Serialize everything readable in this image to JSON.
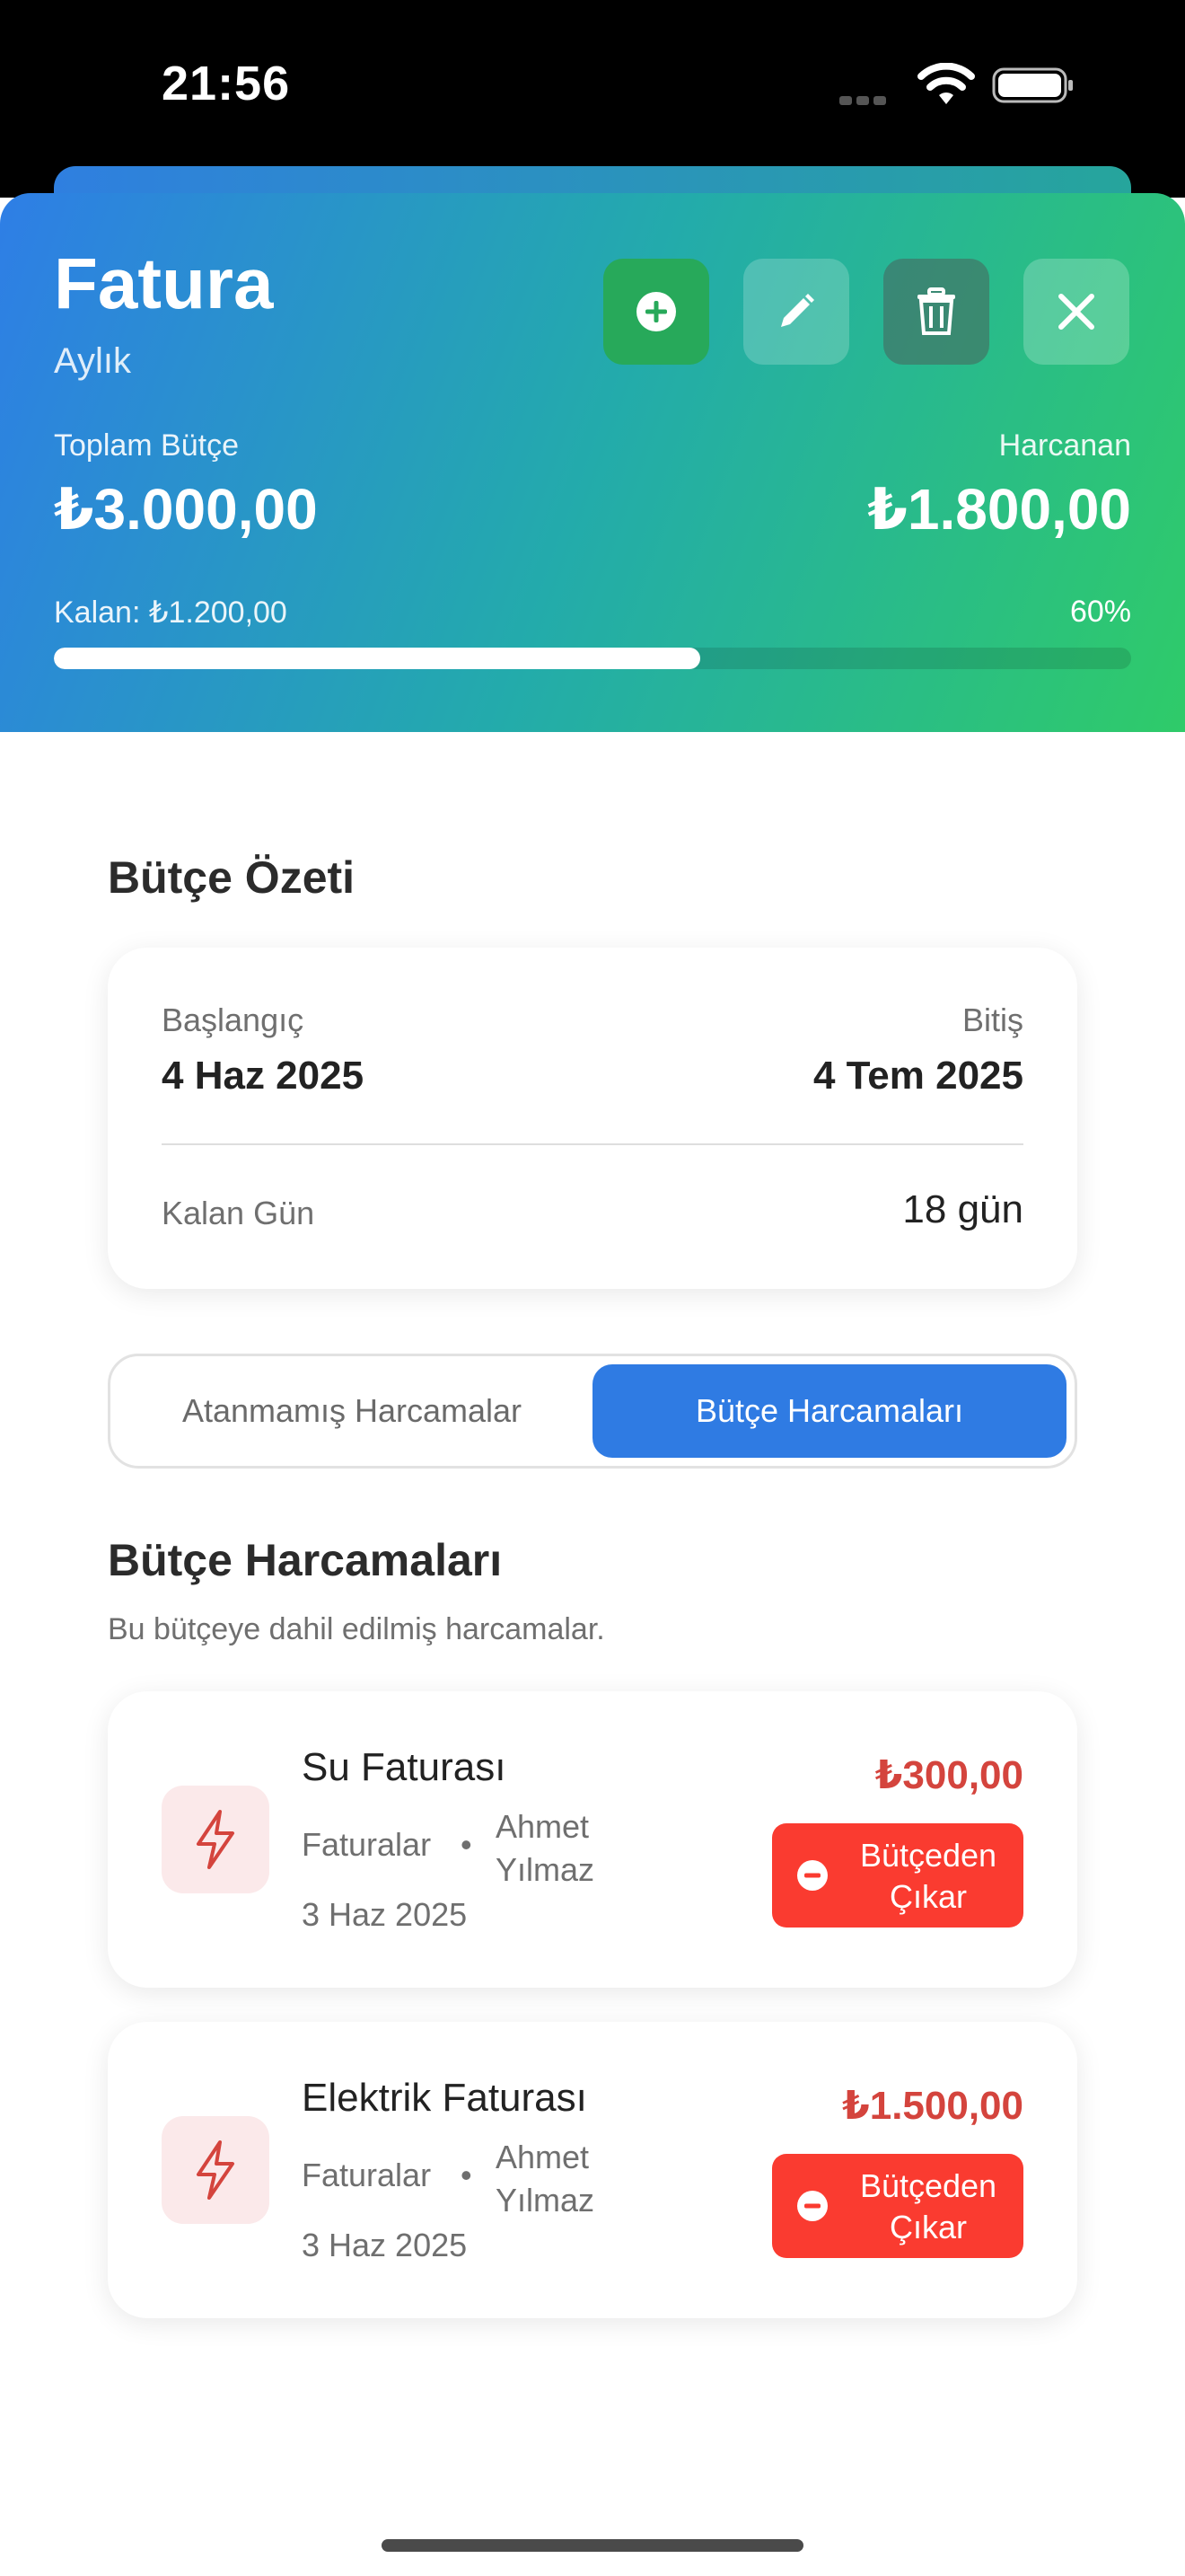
{
  "status_bar": {
    "time": "21:56"
  },
  "header": {
    "title": "Fatura",
    "period": "Aylık",
    "total_label": "Toplam Bütçe",
    "total_value": "₺3.000,00",
    "spent_label": "Harcanan",
    "spent_value": "₺1.800,00",
    "remaining": "Kalan: ₺1.200,00",
    "percent_text": "60%",
    "progress_fraction": 0.6,
    "buttons": [
      "add-icon",
      "edit-icon",
      "trash-icon",
      "close-icon"
    ]
  },
  "summary": {
    "title": "Bütçe Özeti",
    "start_label": "Başlangıç",
    "start_value": "4 Haz 2025",
    "end_label": "Bitiş",
    "end_value": "4 Tem 2025",
    "days_label": "Kalan Gün",
    "days_value": "18 gün"
  },
  "segment": {
    "unassigned_label": "Atanmamış Harcamalar",
    "budget_label": "Bütçe Harcamaları",
    "selected": "Bütçe Harcamaları"
  },
  "expenses_section": {
    "title": "Bütçe Harcamaları",
    "description": "Bu bütçeye dahil edilmiş harcamalar."
  },
  "expenses": [
    {
      "name": "Su Faturası",
      "category": "Faturalar",
      "separator": "•",
      "user": "Ahmet Yılmaz",
      "date": "3 Haz 2025",
      "amount": "₺300,00",
      "action_label": "Bütçeden Çıkar",
      "icon": "lightning-icon"
    },
    {
      "name": "Elektrik Faturası",
      "category": "Faturalar",
      "separator": "•",
      "user": "Ahmet Yılmaz",
      "date": "3 Haz 2025",
      "amount": "₺1.500,00",
      "action_label": "Bütçeden Çıkar",
      "icon": "lightning-icon"
    }
  ],
  "colors": {
    "header_gradient_start": "#2e7ee6",
    "header_gradient_end": "#2fcb69",
    "accent_blue": "#2f7be3",
    "amount_red": "#d4443d",
    "remove_button_red": "#fa3b30",
    "add_button_green": "#27a95a"
  }
}
